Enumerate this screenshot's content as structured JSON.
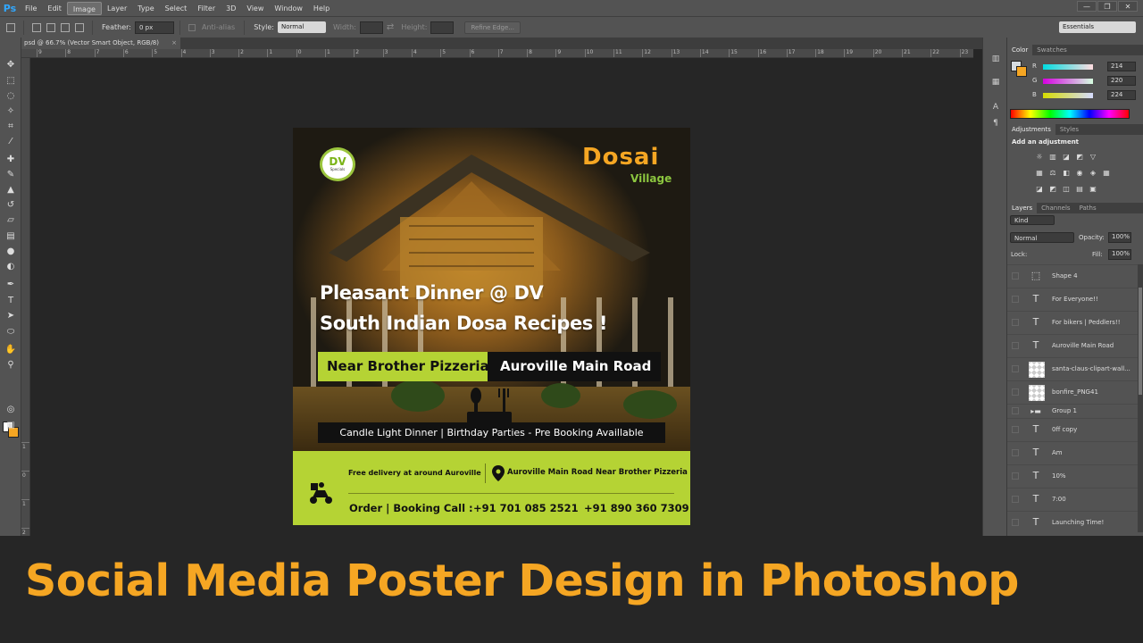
{
  "app": {
    "logo": "Ps"
  },
  "menu": [
    "File",
    "Edit",
    "Image",
    "Layer",
    "Type",
    "Select",
    "Filter",
    "3D",
    "View",
    "Window",
    "Help"
  ],
  "window_controls": {
    "minimize": "—",
    "restore": "❐",
    "close": "✕"
  },
  "options": {
    "feather_label": "Feather:",
    "feather_value": "0 px",
    "antialias_label": "Anti-alias",
    "style_label": "Style:",
    "style_value": "Normal",
    "width_label": "Width:",
    "height_label": "Height:",
    "refine_edge": "Refine Edge...",
    "workspace": "Essentials"
  },
  "document_tab": {
    "title": "psd @ 66.7% (Vector Smart Object, RGB/8)",
    "close": "×"
  },
  "ruler": {
    "h_labels": [
      "9",
      "8",
      "7",
      "6",
      "5",
      "4",
      "3",
      "2",
      "1",
      "0",
      "1",
      "2",
      "3",
      "4",
      "5",
      "6",
      "7",
      "8",
      "9",
      "10",
      "11",
      "12",
      "13",
      "14",
      "15",
      "16",
      "17",
      "18",
      "19",
      "20",
      "21",
      "22",
      "23"
    ],
    "v_labels": [
      "1",
      "0",
      "1",
      "2",
      "3"
    ]
  },
  "poster": {
    "badge": {
      "main": "DV",
      "sub": "Specials"
    },
    "logo": {
      "word": "Dosai",
      "sub": "Village"
    },
    "headline1": "Pleasant Dinner @ DV",
    "headline2": "South Indian Dosa Recipes !",
    "location_green": "Near Brother Pizzeria",
    "location_black": "Auroville Main Road",
    "tagline": "Candle Light Dinner | Birthday Parties - Pre Booking Availlable",
    "delivery": "Free delivery at around Auroville",
    "address": "Auroville Main Road Near Brother Pizzeria",
    "order_label": "Order | Booking Call :",
    "phone1": "+91 701 085 2521",
    "phone2": "+91 890 360 7309"
  },
  "color_panel": {
    "tabs": [
      "Color",
      "Swatches"
    ],
    "channels": [
      {
        "label": "R",
        "value": "214"
      },
      {
        "label": "G",
        "value": "220"
      },
      {
        "label": "B",
        "value": "224"
      }
    ]
  },
  "adjustments_panel": {
    "tabs": [
      "Adjustments",
      "Styles"
    ],
    "add_label": "Add an adjustment"
  },
  "layers_panel": {
    "tabs": [
      "Layers",
      "Channels",
      "Paths"
    ],
    "kind": "Kind",
    "blend_mode": "Normal",
    "opacity_label": "Opacity:",
    "opacity_value": "100%",
    "lock_label": "Lock:",
    "fill_label": "Fill:",
    "fill_value": "100%",
    "layers": [
      {
        "name": "Shape 4",
        "kind": "shape"
      },
      {
        "name": "For Everyone!!",
        "kind": "text"
      },
      {
        "name": "For bikers | Peddlers!!",
        "kind": "text"
      },
      {
        "name": "Auroville Main Road",
        "kind": "text"
      },
      {
        "name": "santa-claus-clipart-wall...",
        "kind": "image"
      },
      {
        "name": "bonfire_PNG41",
        "kind": "image"
      },
      {
        "name": "Group 1",
        "kind": "group"
      },
      {
        "name": "0ff copy",
        "kind": "text"
      },
      {
        "name": "Am",
        "kind": "text"
      },
      {
        "name": "10%",
        "kind": "text"
      },
      {
        "name": "7:00",
        "kind": "text"
      },
      {
        "name": "Launching Time!",
        "kind": "text"
      }
    ]
  },
  "banner": {
    "title": "Social Media Poster Design in Photoshop"
  },
  "colors": {
    "accent_orange": "#f5a623",
    "poster_green": "#b5d334",
    "ui_panel": "#535353",
    "ui_bg": "#262626"
  }
}
